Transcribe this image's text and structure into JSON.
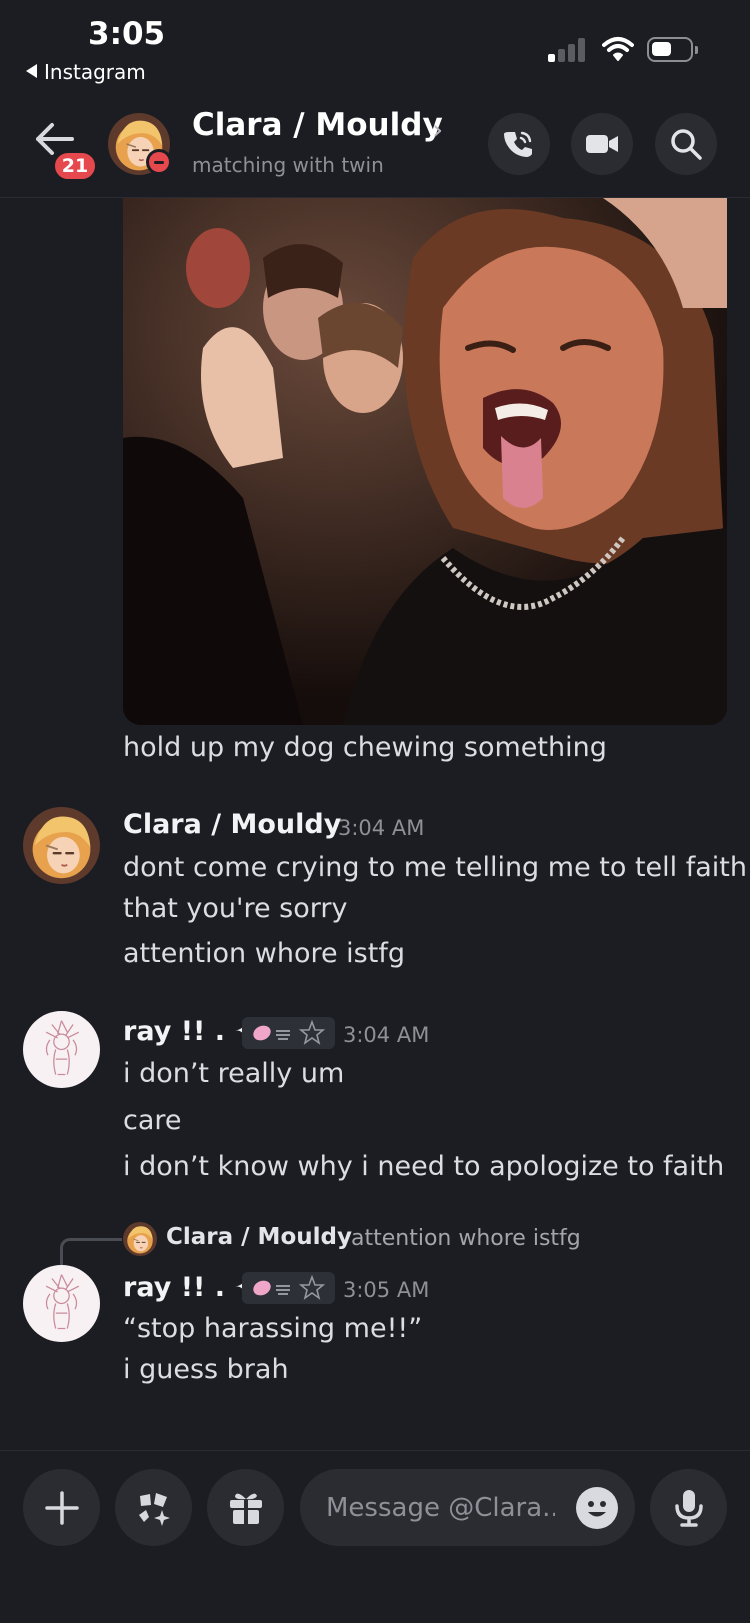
{
  "status_bar": {
    "time": "3:05",
    "back_app": "Instagram"
  },
  "header": {
    "unread_count": "21",
    "name": "Clara / Mouldy",
    "chevron": "›",
    "status": "matching with twin",
    "icons": [
      "back-arrow-icon",
      "voice-call-icon",
      "video-call-icon",
      "search-icon"
    ]
  },
  "messages": {
    "gif_caption": "hold up my dog chewing something",
    "m1": {
      "author": "Clara / Mouldy",
      "time": "3:04 AM",
      "line1": "dont come crying to me telling me to tell faith",
      "line2": "that you're sorry",
      "line3": "attention whore istfg"
    },
    "m2": {
      "author": "ray !! . ✦",
      "time": "3:04 AM",
      "line1": "i don’t really um",
      "line2": "care",
      "line3": "i don’t know why i need to apologize to faith"
    },
    "reply": {
      "author": "Clara / Mouldy",
      "text": "attention whore istfg"
    },
    "m3": {
      "author": "ray !! . ✦",
      "time": "3:05 AM",
      "line1": "“stop harassing me!!”",
      "line2": "i guess brah"
    }
  },
  "composer": {
    "placeholder": "Message @Clara...",
    "icons": [
      "plus-icon",
      "apps-icon",
      "gift-icon",
      "emoji-icon",
      "microphone-icon"
    ]
  },
  "colors": {
    "background": "#1c1d22",
    "badge": "#e5484d",
    "button": "#2b2c32"
  }
}
